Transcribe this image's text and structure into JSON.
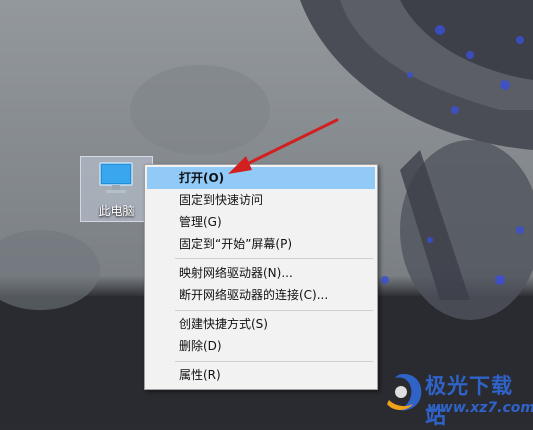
{
  "desktop": {
    "icon_label": "此电脑"
  },
  "menu": {
    "items": [
      {
        "label": "打开(O)"
      },
      {
        "label": "固定到快速访问"
      },
      {
        "label": "管理(G)"
      },
      {
        "label": "固定到“开始”屏幕(P)"
      },
      {
        "label": "映射网络驱动器(N)..."
      },
      {
        "label": "断开网络驱动器的连接(C)..."
      },
      {
        "label": "创建快捷方式(S)"
      },
      {
        "label": "删除(D)"
      },
      {
        "label": "属性(R)"
      }
    ]
  },
  "watermark": {
    "title": "极光下载站",
    "url": "www.xz7.com"
  },
  "colors": {
    "highlight": "#91c9f7",
    "arrow": "#d21f1f",
    "brand": "#2f63c8"
  }
}
